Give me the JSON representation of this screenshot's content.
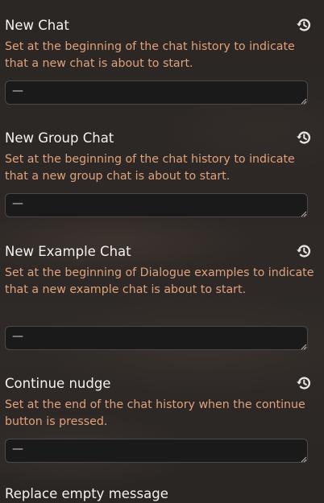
{
  "settings": [
    {
      "title": "New Chat",
      "description": "Set at the beginning of the chat history to indicate that a new chat is about to start.",
      "value": "—"
    },
    {
      "title": "New Group Chat",
      "description": "Set at the beginning of the chat history to indicate that a new group chat is about to start.",
      "value": "—"
    },
    {
      "title": "New Example Chat",
      "description": "Set at the beginning of Dialogue examples to indicate that a new example chat is about to start.",
      "value": "—"
    },
    {
      "title": "Continue nudge",
      "description": "Set at the end of the chat history when the continue button is pressed.",
      "value": "—"
    }
  ],
  "next_setting_title": "Replace empty message",
  "icons": {
    "reset": "history-reset-icon"
  },
  "colors": {
    "description_text": "#e0a27a",
    "title_text": "#f4f1ee",
    "textbox_background": "#1b1a1a",
    "textbox_border": "#4d4846"
  }
}
